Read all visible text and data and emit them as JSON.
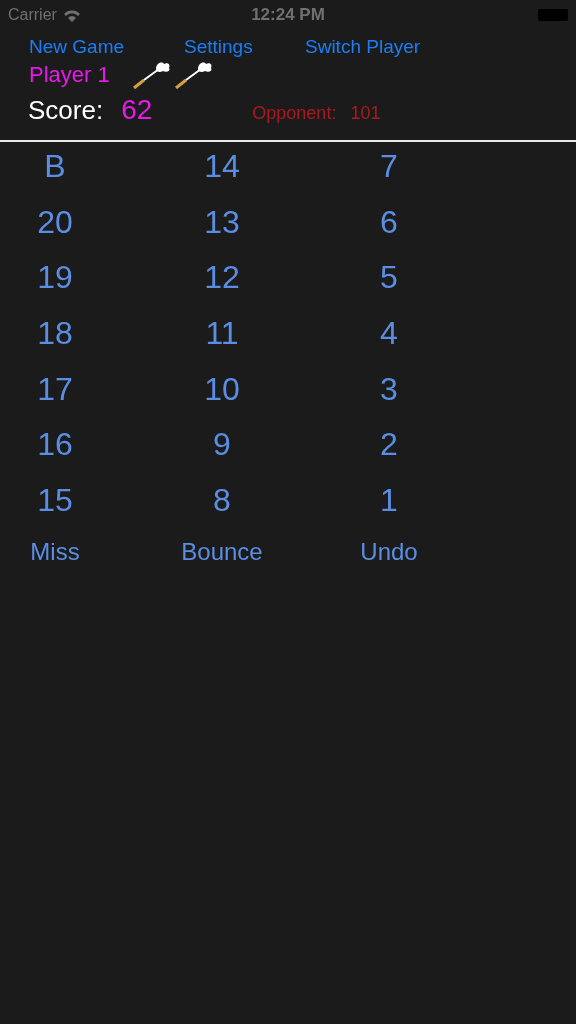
{
  "status_bar": {
    "carrier": "Carrier",
    "time": "12:24 PM"
  },
  "nav": [
    "New Game",
    "Settings",
    "Switch Player"
  ],
  "player": {
    "name": "Player 1",
    "darts": [
      {
        "kind": "dart"
      },
      {
        "kind": "dart"
      }
    ]
  },
  "score": {
    "label": "Score:",
    "value": "62"
  },
  "opponent": {
    "label": "Opponent:",
    "value": "101"
  },
  "targets": [
    [
      "B",
      "14",
      "7"
    ],
    [
      "20",
      "13",
      "6"
    ],
    [
      "19",
      "12",
      "5"
    ],
    [
      "18",
      "11",
      "4"
    ],
    [
      "17",
      "10",
      "3"
    ],
    [
      "16",
      "9",
      "2"
    ],
    [
      "15",
      "8",
      "1"
    ]
  ],
  "actions": [
    "Miss",
    "Bounce",
    "Undo"
  ]
}
